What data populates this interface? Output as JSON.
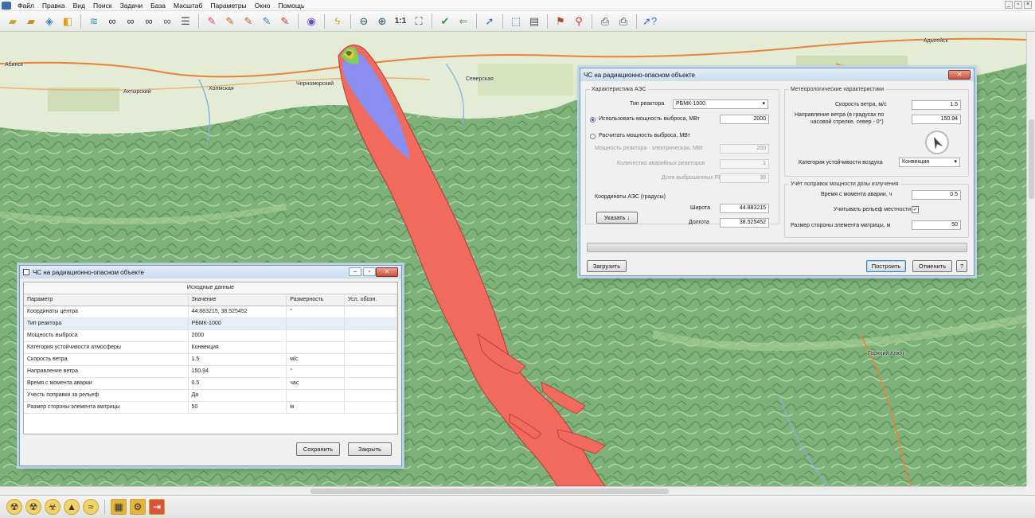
{
  "menu": [
    "Файл",
    "Правка",
    "Вид",
    "Поиск",
    "Задачи",
    "База",
    "Масштаб",
    "Параметры",
    "Окно",
    "Помощь"
  ],
  "toolbar": {
    "scale_label": "1:1"
  },
  "icons": {
    "toolbar": [
      "folder-open-icon",
      "folder-save-icon",
      "layers-icon",
      "layer-add-icon",
      "layers-stack-icon",
      "binoculars-icon",
      "binoculars-a-icon",
      "binoculars-next-icon",
      "binoculars-prev-icon",
      "list-icon",
      "pencil-eraser-icon",
      "pencil-add-icon",
      "pencil-move-icon",
      "pencil-edit-icon",
      "pencil-delete-icon",
      "globe-icon",
      "lightning-icon",
      "zoom-out-icon",
      "zoom-in-icon",
      "fit-icon",
      "check-icon",
      "arrow-back-icon",
      "cursor-icon",
      "select-window-icon",
      "document-text-icon",
      "stamp-icon",
      "map-marker-icon",
      "printer-icon",
      "printer-settings-icon",
      "help-cursor-icon"
    ],
    "bottom": [
      "radiation-icon",
      "radiation-plume-icon",
      "chemical-icon",
      "fire-icon",
      "flood-icon",
      "hazard-zone-icon",
      "gear-icon",
      "exit-icon"
    ]
  },
  "colors": {
    "plume_outer": "#f06a5e",
    "plume_mid": "#8a8ef0",
    "plume_inner_green": "#7ccf5a",
    "plume_core": "#f2c23a",
    "map_relief": "#7fb27a",
    "accent": "#3c7fb1"
  },
  "map": {
    "cities": [
      "Абинск",
      "Ахтырский",
      "Холмская",
      "Черноморский",
      "Северская",
      "Адыгейск",
      "Горячий Ключ"
    ]
  },
  "param_dialog": {
    "title": "ЧС на радиационно-опасном объекте",
    "plant_group_title": "Характеристика АЭС",
    "reactor_type_label": "Тип реактора",
    "reactor_type_value": "РБМК-1000",
    "use_power_label": "Использовать мощность выброса, МВт",
    "use_power_value": "2000",
    "calc_power_label": "Расчитать мощность выброса, МВт",
    "reactor_power_label": "Мощность реактора - электрическая, МВт",
    "reactor_power_value": "200",
    "reactor_count_label": "Количество аварийных реакторов",
    "reactor_count_value": "1",
    "rv_share_label": "Доля выброшенных РВ, %",
    "rv_share_value": "35",
    "coords_label": "Координаты АЭС (градусы)",
    "point_button": "Указать ↓",
    "lat_label": "Широта",
    "lat_value": "44.883215",
    "lon_label": "Долгота",
    "lon_value": "38.525452",
    "meteo_title": "Метеорологические характеристики",
    "wind_speed_label": "Скорость ветра, м/с",
    "wind_speed_value": "1.5",
    "wind_dir_label_1": "Направление ветра (в градусах по",
    "wind_dir_label_2": "часовой стрелке, север - 0°)",
    "wind_dir_value": "150.94",
    "stability_label": "Категория устойчивости воздуха",
    "stability_value": "Конвекция",
    "corrections_title": "Учёт поправок мощности дозы излучения",
    "time_label": "Время с момента аварии, ч",
    "time_value": "0.5",
    "relief_label": "Учитывать рельеф местности",
    "relief_checked": true,
    "matrix_label": "Размер стороны элемента матрицы, м",
    "matrix_value": "50",
    "load_button": "Загрузить",
    "build_button": "Построить",
    "cancel_button": "Отменить",
    "help_button": "?"
  },
  "result_dialog": {
    "title": "ЧС на радиационно-опасном объекте",
    "table_title": "Исходные данные",
    "columns": [
      "Параметр",
      "Значение",
      "Размерность",
      "Усл. обозн."
    ],
    "rows": [
      [
        "Координаты центра",
        "44.883215, 38.525452",
        "°",
        ""
      ],
      [
        "Тип реактора",
        "РБМК-1000",
        "",
        ""
      ],
      [
        "Мощность выброса",
        "2000",
        "",
        ""
      ],
      [
        "Категория устойчивости атмосферы",
        "Конвекция",
        "",
        ""
      ],
      [
        "Скорость ветра",
        "1.5",
        "м/с",
        ""
      ],
      [
        "Направление ветра",
        "150.94",
        "°",
        ""
      ],
      [
        "Время с момента аварии",
        "0.5",
        "час",
        ""
      ],
      [
        "Учесть поправки за рельеф",
        "Да",
        "",
        ""
      ],
      [
        "Размер стороны элемента матрицы",
        "50",
        "м",
        ""
      ]
    ],
    "save_button": "Сохранить",
    "close_button": "Закрыть"
  }
}
